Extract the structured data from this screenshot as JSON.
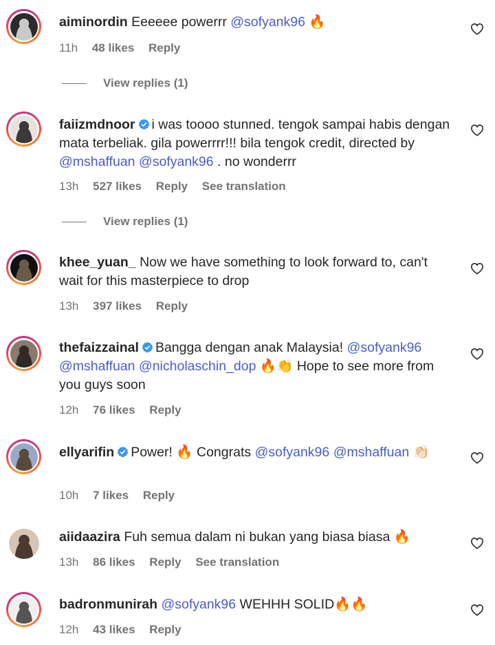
{
  "comments": [
    {
      "username": "aiminordin",
      "verified": false,
      "text_segments": [
        {
          "t": "text",
          "v": "Eeeeee powerrr "
        },
        {
          "t": "mention",
          "v": "@sofyank96"
        },
        {
          "t": "text",
          "v": " 🔥"
        }
      ],
      "time": "11h",
      "likes": "48 likes",
      "reply": "Reply",
      "translate": "",
      "view_replies": "View replies (1)",
      "avatar_colors": [
        "#2b2b2b",
        "#c9c9c9"
      ]
    },
    {
      "username": "faiizmdnoor",
      "verified": true,
      "text_segments": [
        {
          "t": "text",
          "v": "i was toooo stunned. tengok sampai habis dengan mata terbeliak. gila powerrrr!!! bila tengok credit, directed by "
        },
        {
          "t": "mention",
          "v": "@mshaffuan"
        },
        {
          "t": "text",
          "v": " "
        },
        {
          "t": "mention",
          "v": "@sofyank96"
        },
        {
          "t": "text",
          "v": " . no wonderrr"
        }
      ],
      "time": "13h",
      "likes": "527 likes",
      "reply": "Reply",
      "translate": "See translation",
      "view_replies": "View replies (1)",
      "avatar_colors": [
        "#e8e2dc",
        "#3a3a3a"
      ]
    },
    {
      "username": "khee_yuan_",
      "verified": false,
      "text_segments": [
        {
          "t": "text",
          "v": "Now we have something to look forward to, can't wait for this masterpiece to drop"
        }
      ],
      "time": "13h",
      "likes": "397 likes",
      "reply": "Reply",
      "translate": "",
      "view_replies": "",
      "avatar_colors": [
        "#111111",
        "#6b5a4a"
      ]
    },
    {
      "username": "thefaizzainal",
      "verified": true,
      "text_segments": [
        {
          "t": "text",
          "v": "Bangga dengan anak Malaysia! "
        },
        {
          "t": "mention",
          "v": "@sofyank96"
        },
        {
          "t": "text",
          "v": " "
        },
        {
          "t": "mention",
          "v": "@mshaffuan"
        },
        {
          "t": "text",
          "v": " "
        },
        {
          "t": "mention",
          "v": "@nicholaschin_dop"
        },
        {
          "t": "text",
          "v": " 🔥👏 Hope to see more from you guys soon"
        }
      ],
      "time": "12h",
      "likes": "76 likes",
      "reply": "Reply",
      "translate": "",
      "view_replies": "",
      "avatar_colors": [
        "#8a7a6a",
        "#2e2a26"
      ]
    },
    {
      "username": "ellyarifin",
      "verified": true,
      "text_segments": [
        {
          "t": "text",
          "v": "Power! 🔥 Congrats "
        },
        {
          "t": "mention",
          "v": "@sofyank96"
        },
        {
          "t": "text",
          "v": " "
        },
        {
          "t": "mention",
          "v": "@mshaffuan"
        },
        {
          "t": "text",
          "v": " 👏🏻"
        }
      ],
      "time": "10h",
      "likes": "7 likes",
      "reply": "Reply",
      "translate": "",
      "view_replies": "",
      "avatar_colors": [
        "#9aa8c8",
        "#5a4a3a"
      ]
    },
    {
      "username": "aiidaazira",
      "verified": false,
      "text_segments": [
        {
          "t": "text",
          "v": "Fuh semua dalam ni bukan yang biasa biasa 🔥"
        }
      ],
      "time": "13h",
      "likes": "86 likes",
      "reply": "Reply",
      "translate": "See translation",
      "view_replies": "",
      "avatar_colors": [
        "#d8c4b4",
        "#4a3a30"
      ]
    },
    {
      "username": "badronmunirah",
      "verified": false,
      "text_segments": [
        {
          "t": "mention",
          "v": "@sofyank96"
        },
        {
          "t": "text",
          "v": " WEHHH SOLID🔥🔥"
        }
      ],
      "time": "12h",
      "likes": "43 likes",
      "reply": "Reply",
      "translate": "",
      "view_replies": "",
      "avatar_colors": [
        "#efefef",
        "#555555"
      ]
    }
  ],
  "colors": {
    "mention": "#4a5cc9",
    "meta": "#737373",
    "verified": "#3897f0",
    "text": "#262626"
  },
  "icons": {
    "like": "heart-outline-icon",
    "verified": "verified-badge-icon"
  }
}
